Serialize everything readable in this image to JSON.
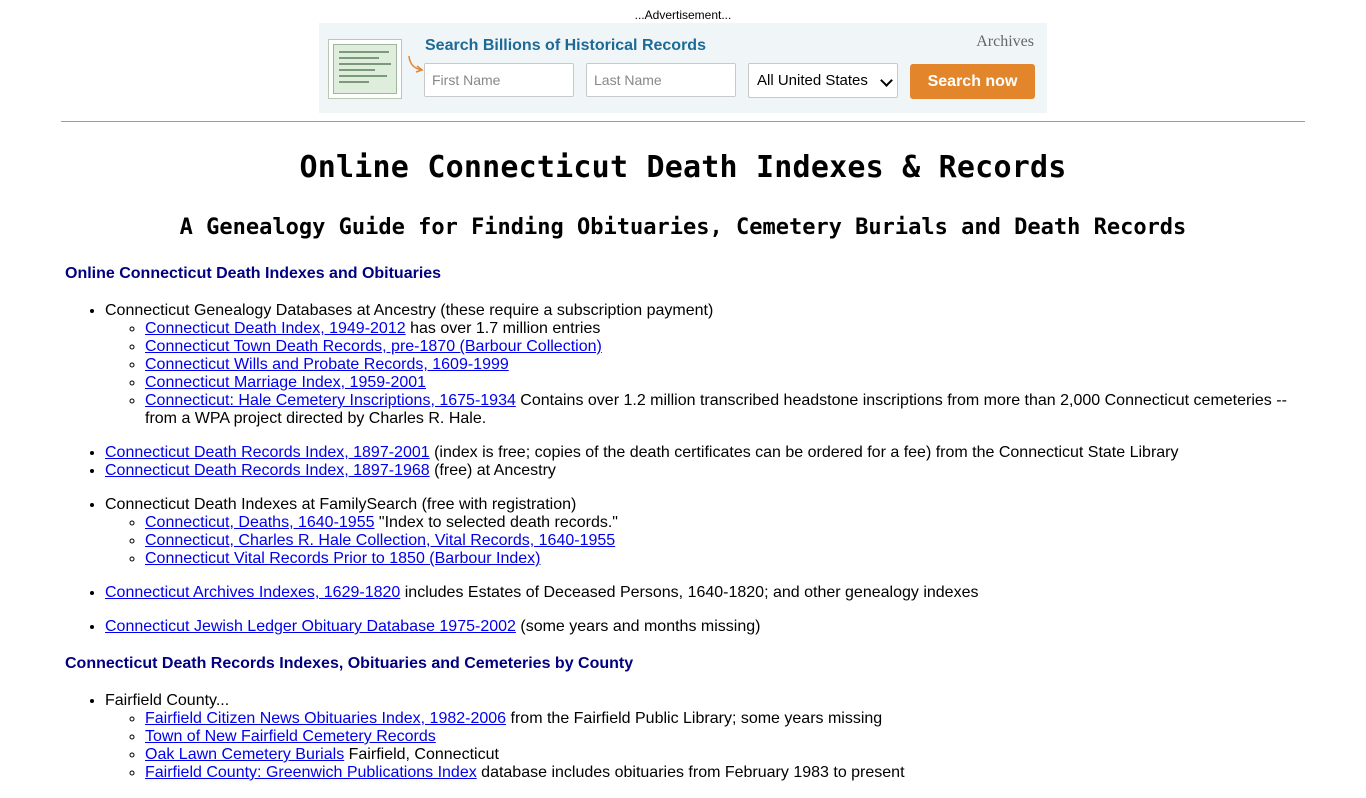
{
  "ad": {
    "label": "...Advertisement...",
    "title": "Search Billions of Historical Records",
    "brand": "Archives",
    "first_name_placeholder": "First Name",
    "last_name_placeholder": "Last Name",
    "location_selected": "All United States",
    "button_label": "Search now",
    "colors": {
      "title": "#1d6a96",
      "button": "#e3862b",
      "background": "#f0f5f8"
    }
  },
  "page": {
    "title": "Online Connecticut Death Indexes & Records",
    "subtitle": "A Genealogy Guide for Finding Obituaries, Cemetery Burials and Death Records"
  },
  "section1": {
    "heading": "Online Connecticut Death Indexes and Obituaries",
    "ancestry": {
      "text": "Connecticut Genealogy Databases at Ancestry (these require a subscription payment)",
      "items": [
        {
          "link": "Connecticut Death Index, 1949-2012",
          "text": " has over 1.7 million entries"
        },
        {
          "link": "Connecticut Town Death Records, pre-1870 (Barbour Collection)",
          "text": ""
        },
        {
          "link": "Connecticut Wills and Probate Records, 1609-1999",
          "text": ""
        },
        {
          "link": "Connecticut Marriage Index, 1959-2001",
          "text": ""
        },
        {
          "link": "Connecticut: Hale Cemetery Inscriptions, 1675-1934",
          "text": " Contains over 1.2 million transcribed headstone inscriptions from more than 2,000 Connecticut cemeteries -- from a WPA project directed by Charles R. Hale."
        }
      ]
    },
    "state_library": [
      {
        "link": "Connecticut Death Records Index, 1897-2001",
        "text": " (index is free; copies of the death certificates can be ordered for a fee) from the Connecticut State Library"
      },
      {
        "link": "Connecticut Death Records Index, 1897-1968",
        "text": " (free) at Ancestry"
      }
    ],
    "familysearch": {
      "text": "Connecticut Death Indexes at FamilySearch (free with registration)",
      "items": [
        {
          "link": "Connecticut, Deaths, 1640-1955",
          "text": " \"Index to selected death records.\""
        },
        {
          "link": "Connecticut, Charles R. Hale Collection, Vital Records, 1640-1955",
          "text": ""
        },
        {
          "link": "Connecticut Vital Records Prior to 1850 (Barbour Index)",
          "text": ""
        }
      ]
    },
    "archives": {
      "link": "Connecticut Archives Indexes, 1629-1820",
      "text": " includes Estates of Deceased Persons, 1640-1820; and other genealogy indexes"
    },
    "jewish": {
      "link": "Connecticut Jewish Ledger Obituary Database 1975-2002",
      "text": " (some years and months missing)"
    }
  },
  "section2": {
    "heading": "Connecticut Death Records Indexes, Obituaries and Cemeteries by County",
    "fairfield": {
      "text": "Fairfield County...",
      "items": [
        {
          "link": "Fairfield Citizen News Obituaries Index, 1982-2006",
          "text": " from the Fairfield Public Library; some years missing"
        },
        {
          "link": "Town of New Fairfield Cemetery Records",
          "text": ""
        },
        {
          "link": "Oak Lawn Cemetery Burials",
          "text": " Fairfield, Connecticut"
        },
        {
          "link": "Fairfield County: Greenwich Publications Index",
          "text": " database includes obituaries from February 1983 to present"
        }
      ]
    }
  }
}
